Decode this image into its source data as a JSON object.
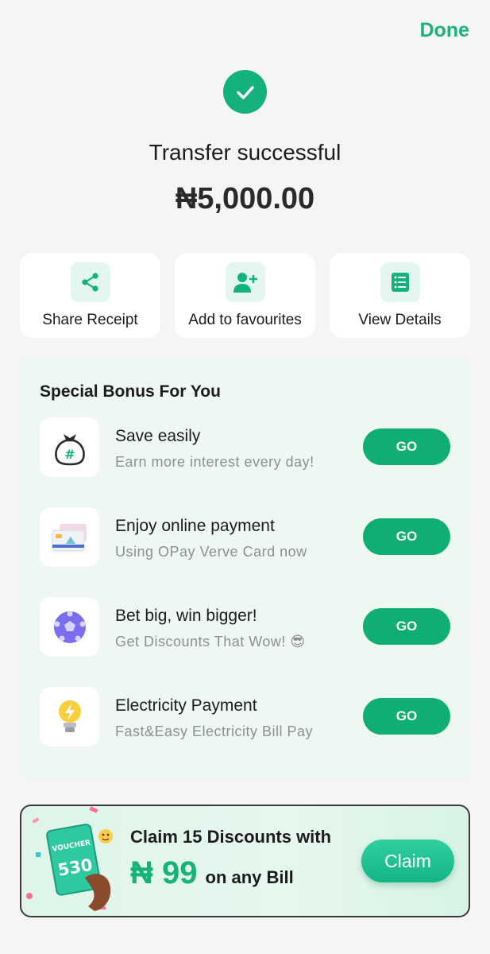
{
  "header": {
    "done_label": "Done"
  },
  "result": {
    "title": "Transfer successful",
    "amount": "₦5,000.00"
  },
  "actions": [
    {
      "label": "Share Receipt",
      "icon": "share-icon"
    },
    {
      "label": "Add to favourites",
      "icon": "add-user-icon"
    },
    {
      "label": "View Details",
      "icon": "document-list-icon"
    }
  ],
  "bonus": {
    "title": "Special Bonus For You",
    "items": [
      {
        "title": "Save easily",
        "subtitle": "Earn more interest every day!",
        "button": "GO",
        "icon": "money-bag-icon"
      },
      {
        "title": "Enjoy online payment",
        "subtitle": "Using OPay Verve Card now",
        "button": "GO",
        "icon": "card-icon"
      },
      {
        "title": "Bet big, win bigger!",
        "subtitle": "Get Discounts That Wow! 😎",
        "button": "GO",
        "icon": "football-icon"
      },
      {
        "title": "Electricity Payment",
        "subtitle": "Fast&Easy Electricity Bill Pay",
        "button": "GO",
        "icon": "lightbulb-icon"
      }
    ]
  },
  "banner": {
    "line1": "Claim 15 Discounts with",
    "amount": "₦ 99",
    "suffix": "on any Bill",
    "voucher_label": "VOUCHER",
    "voucher_number": "530",
    "claim_label": "Claim"
  },
  "colors": {
    "accent": "#12b27a",
    "background": "#f5f5f7",
    "bonus_panel": "#eef8f3"
  }
}
